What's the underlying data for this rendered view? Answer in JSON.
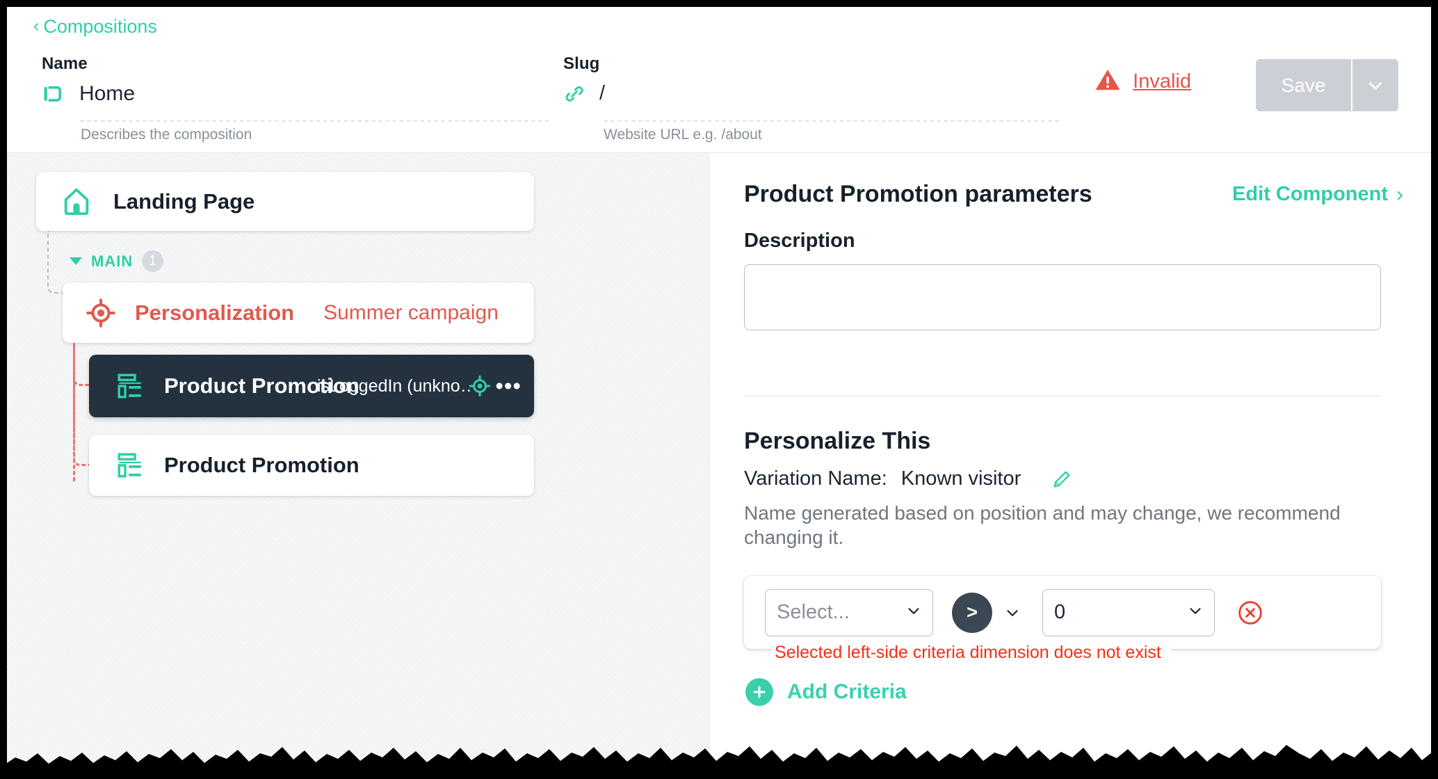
{
  "breadcrumb": {
    "label": "Compositions",
    "icon": "chevron-left-icon"
  },
  "name_field": {
    "label": "Name",
    "value": "Home",
    "help": "Describes the composition",
    "icon": "composition-icon"
  },
  "slug_field": {
    "label": "Slug",
    "value": "/",
    "help": "Website URL e.g. /about",
    "icon": "link-icon"
  },
  "status": {
    "label": "Invalid",
    "icon": "warning-triangle-icon",
    "color": "#e8544a"
  },
  "save": {
    "label": "Save",
    "caret_icon": "chevron-down-icon",
    "disabled_color": "#ccd0d6"
  },
  "tree": {
    "root": {
      "title": "Landing Page",
      "icon": "home-icon"
    },
    "slot": {
      "label": "MAIN",
      "count": "1",
      "toggle_icon": "caret-down-icon"
    },
    "nodes": [
      {
        "title": "Personalization",
        "subtitle": "Summer campaign",
        "icon": "target-icon",
        "color": "#e05a4f"
      },
      {
        "title": "Product Promotion",
        "meta": "isLoggedIn (unkno…",
        "icon": "component-layout-icon",
        "target_icon": "target-icon",
        "menu_icon": "ellipsis-icon",
        "selected": true
      },
      {
        "title": "Product Promotion",
        "icon": "component-layout-icon",
        "selected": false
      }
    ]
  },
  "params": {
    "title": "Product Promotion parameters",
    "edit_component": {
      "label": "Edit Component",
      "icon": "chevron-right-icon"
    },
    "description": {
      "label": "Description",
      "value": ""
    }
  },
  "personalize": {
    "title": "Personalize This",
    "variation_label": "Variation Name:",
    "variation_value": "Known visitor",
    "edit_icon": "pencil-icon",
    "note": "Name generated based on position and may change, we recommend changing it.",
    "criteria": {
      "left_value": "Select...",
      "left_is_placeholder": true,
      "operator": ">",
      "operator_caret_icon": "chevron-down-icon",
      "right_value": "0",
      "remove_icon": "remove-circle-icon",
      "error": "Selected left-side criteria dimension does not exist"
    },
    "add_criteria": {
      "label": "Add Criteria",
      "icon": "plus-circle-icon"
    }
  },
  "colors": {
    "accent": "#2ecfa8",
    "danger": "#e05a4f",
    "dark": "#243240",
    "error_text": "#fa2c15"
  }
}
